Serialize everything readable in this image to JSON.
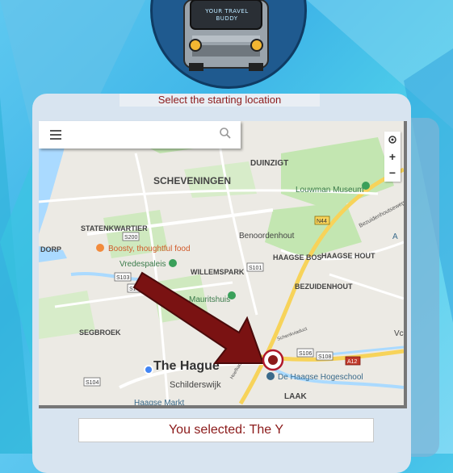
{
  "logo": {
    "text_line1": "YOUR TRAVEL",
    "text_line2": "BUDDY"
  },
  "title": "Select the starting location",
  "map": {
    "areas": [
      {
        "name": "DUINZIGT"
      },
      {
        "name": "SCHEVENINGEN"
      },
      {
        "name": "Louwman Museum"
      },
      {
        "name": "STATENKWARTIER"
      },
      {
        "name": "Benoordenhout"
      },
      {
        "name": "Boosty, thoughtful food"
      },
      {
        "name": "Vredespaleis"
      },
      {
        "name": "WILLEMSPARK"
      },
      {
        "name": "HAAGSE BOS"
      },
      {
        "name": "HAAGSE HOUT"
      },
      {
        "name": "DORP"
      },
      {
        "name": "BEZUIDENHOUT"
      },
      {
        "name": "Mauritshuis"
      },
      {
        "name": "SEGBROEK"
      },
      {
        "name": "The Hague"
      },
      {
        "name": "Schilderswijk"
      },
      {
        "name": "De Haagse Hogeschool"
      },
      {
        "name": "LAAK"
      },
      {
        "name": "Haagse Markt"
      },
      {
        "name": "Bezuidenhoutseweg"
      },
      {
        "name": "Schenkviaduct"
      },
      {
        "name": "Hoefkade"
      },
      {
        "name": "Vc"
      },
      {
        "name": "A"
      }
    ],
    "roads": [
      "S200",
      "S100",
      "S103",
      "S101",
      "S106",
      "S104",
      "S108",
      "N44",
      "A12"
    ],
    "controls": {
      "zoom_in": "+",
      "zoom_out": "−"
    }
  },
  "selection": {
    "text": "You selected: The Y"
  },
  "colors": {
    "accent": "#8b1a1a",
    "arrow": "#7a1212",
    "pin": "#b0182a"
  },
  "icons": [
    "menu-icon",
    "search-icon",
    "location-icon",
    "location-pin-icon",
    "arrow-icon",
    "bus-icon"
  ]
}
